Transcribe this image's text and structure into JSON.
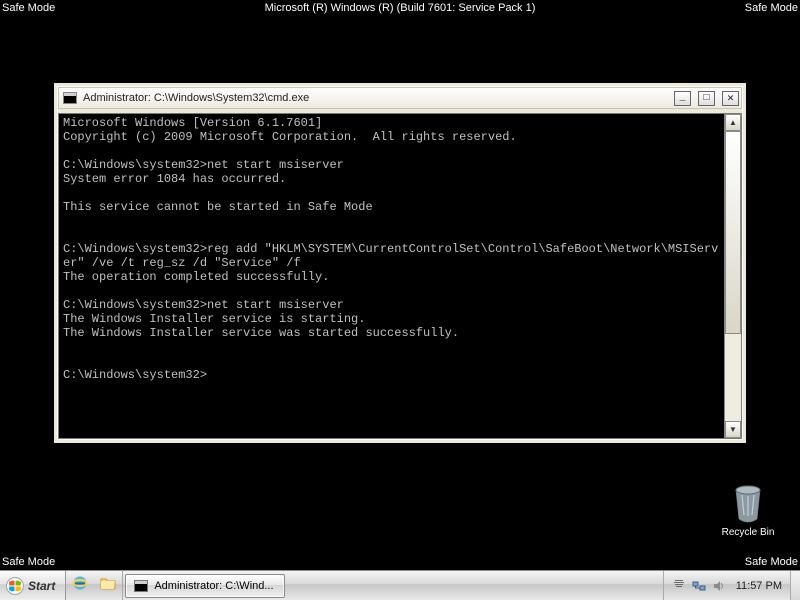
{
  "safe_mode_label": "Safe Mode",
  "build_label": "Microsoft (R) Windows (R) (Build 7601: Service Pack 1)",
  "recycle_bin_label": "Recycle Bin",
  "taskbar": {
    "start_label": "Start",
    "task_button_label": "Administrator: C:\\Wind...",
    "clock": "11:57 PM"
  },
  "cmd": {
    "title": "Administrator: C:\\Windows\\System32\\cmd.exe",
    "lines": [
      "Microsoft Windows [Version 6.1.7601]",
      "Copyright (c) 2009 Microsoft Corporation.  All rights reserved.",
      "",
      "C:\\Windows\\system32>net start msiserver",
      "System error 1084 has occurred.",
      "",
      "This service cannot be started in Safe Mode",
      "",
      "",
      "C:\\Windows\\system32>reg add \"HKLM\\SYSTEM\\CurrentControlSet\\Control\\SafeBoot\\Network\\MSIServer\" /ve /t reg_sz /d \"Service\" /f",
      "The operation completed successfully.",
      "",
      "C:\\Windows\\system32>net start msiserver",
      "The Windows Installer service is starting.",
      "The Windows Installer service was started successfully.",
      "",
      "",
      "C:\\Windows\\system32>"
    ]
  }
}
